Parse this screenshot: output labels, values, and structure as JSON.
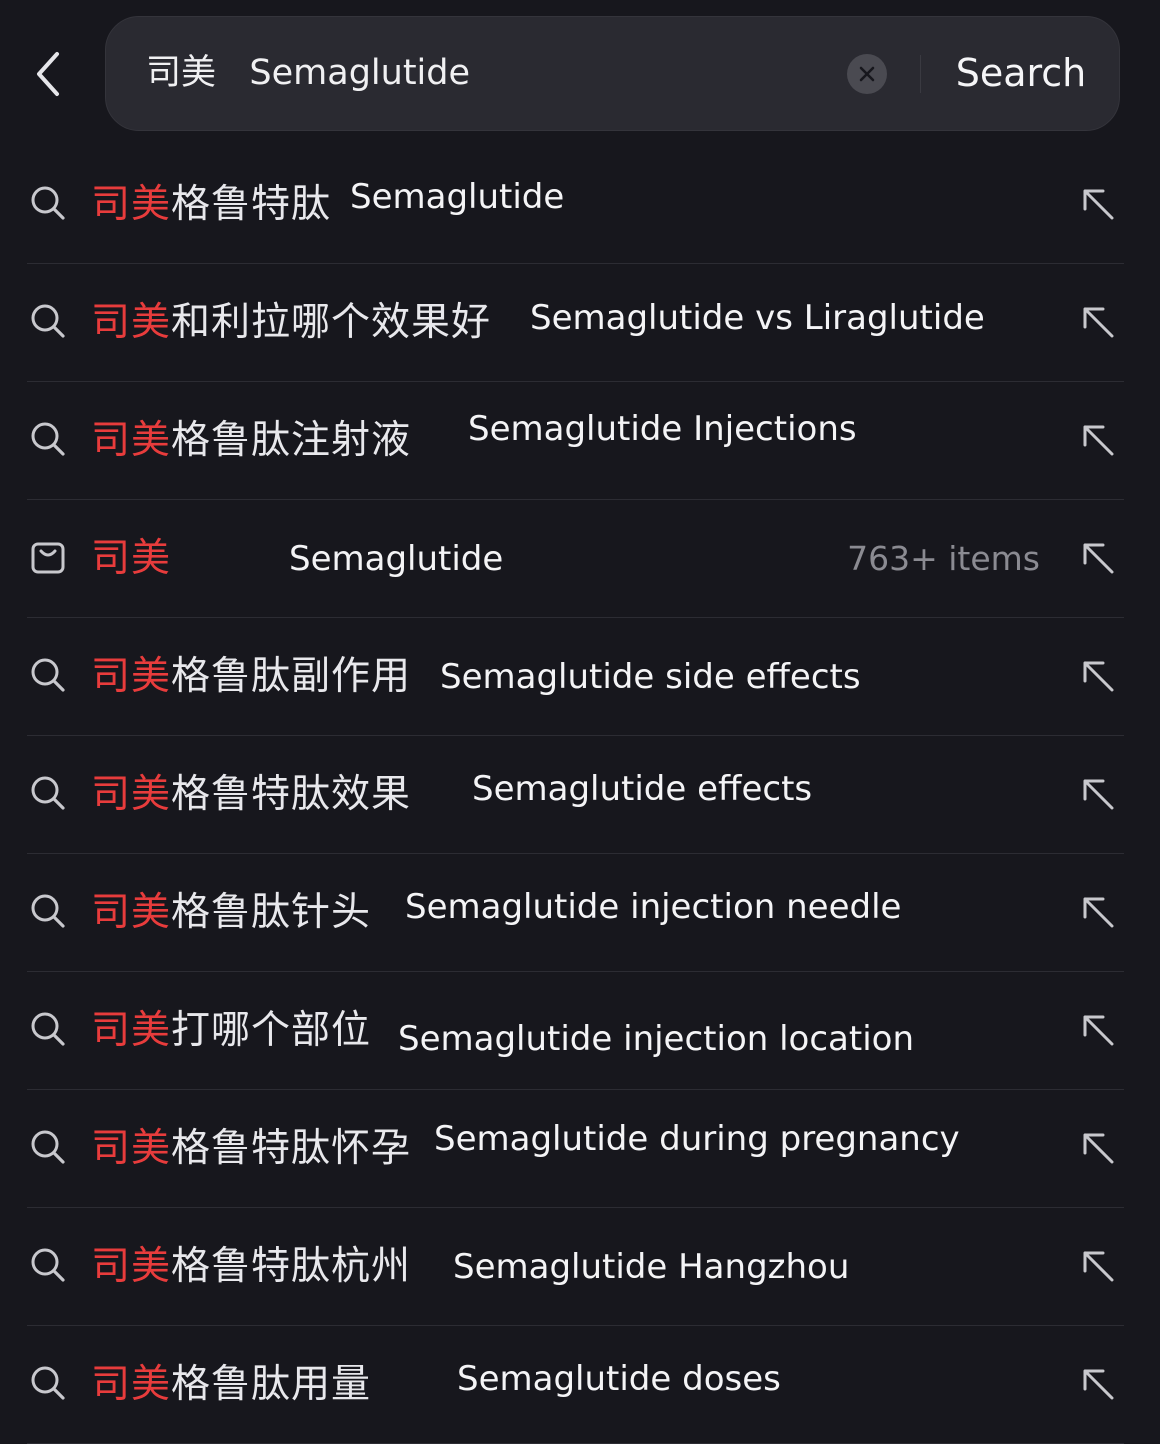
{
  "search": {
    "query_cn": "司美",
    "query_en": "Semaglutide",
    "button_label": "Search"
  },
  "colors": {
    "highlight": "#e83c3c",
    "background": "#17171d",
    "search_box": "#2a2a31"
  },
  "suggestions": [
    {
      "icon": "search-icon",
      "hl": "司美",
      "rest": "格鲁特肽",
      "en": "Semaglutide",
      "count": ""
    },
    {
      "icon": "search-icon",
      "hl": "司美",
      "rest": "和利拉哪个效果好",
      "en": "Semaglutide vs Liraglutide",
      "count": ""
    },
    {
      "icon": "search-icon",
      "hl": "司美",
      "rest": "格鲁肽注射液",
      "en": "Semaglutide Injections",
      "count": ""
    },
    {
      "icon": "shopping-bag-icon",
      "hl": "司美",
      "rest": "",
      "en": "Semaglutide",
      "count": "763+ items"
    },
    {
      "icon": "search-icon",
      "hl": "司美",
      "rest": "格鲁肽副作用",
      "en": "Semaglutide side effects",
      "count": ""
    },
    {
      "icon": "search-icon",
      "hl": "司美",
      "rest": "格鲁特肽效果",
      "en": "Semaglutide effects",
      "count": ""
    },
    {
      "icon": "search-icon",
      "hl": "司美",
      "rest": "格鲁肽针头",
      "en": "Semaglutide injection needle",
      "count": ""
    },
    {
      "icon": "search-icon",
      "hl": "司美",
      "rest": "打哪个部位",
      "en": "Semaglutide injection location",
      "count": ""
    },
    {
      "icon": "search-icon",
      "hl": "司美",
      "rest": "格鲁特肽怀孕",
      "en": "Semaglutide during pregnancy",
      "count": ""
    },
    {
      "icon": "search-icon",
      "hl": "司美",
      "rest": "格鲁特肽杭州",
      "en": "Semaglutide Hangzhou",
      "count": ""
    },
    {
      "icon": "search-icon",
      "hl": "司美",
      "rest": "格鲁肽用量",
      "en": "Semaglutide doses",
      "count": ""
    }
  ]
}
